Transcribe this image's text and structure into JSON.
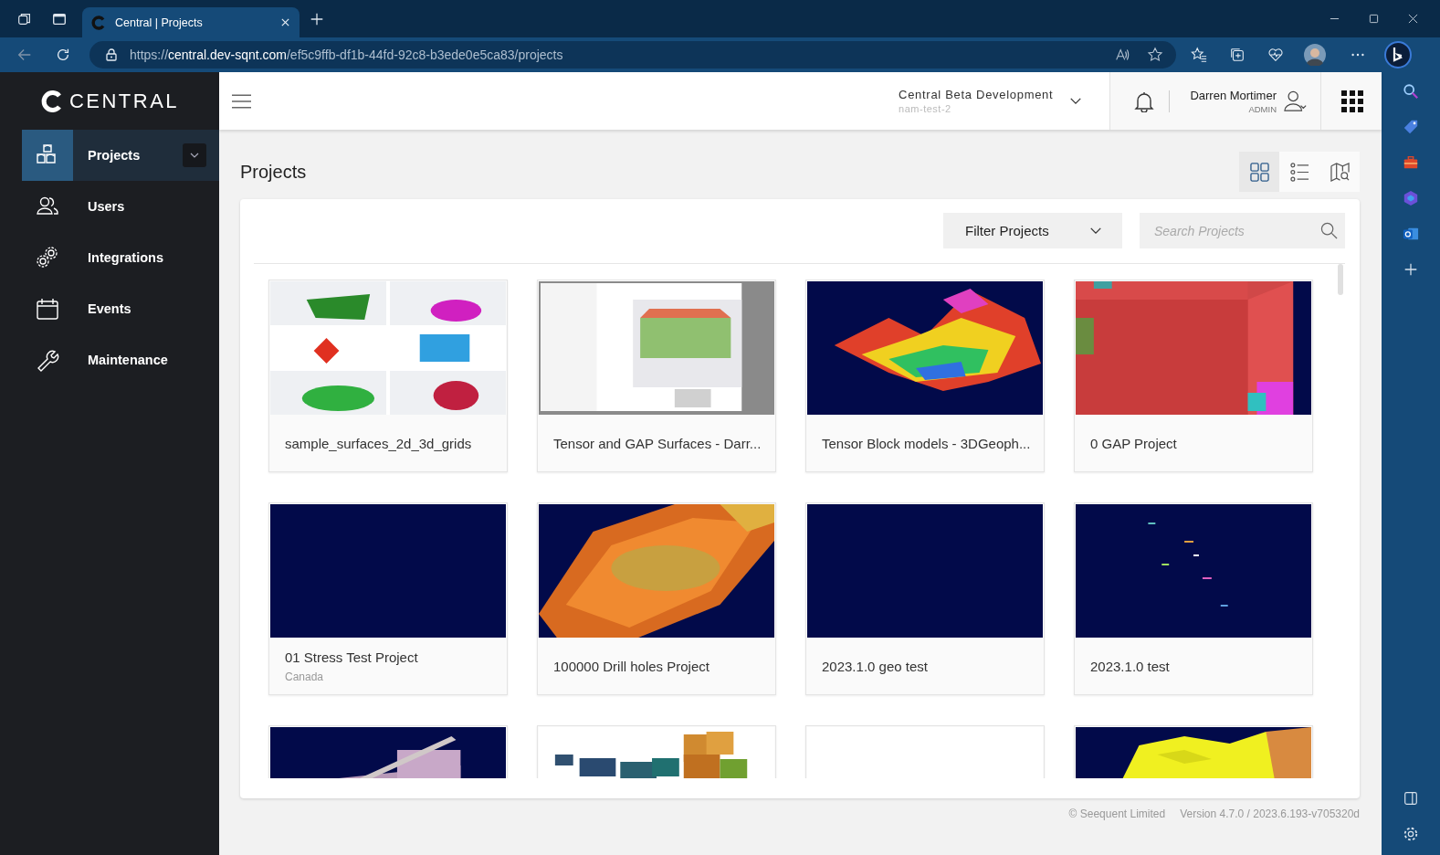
{
  "browser": {
    "tab": {
      "title": "Central | Projects",
      "selected": true
    },
    "url": {
      "scheme": "https://",
      "host": "central.dev-sqnt.com",
      "path": "/ef5c9ffb-df1b-44fd-92c8-b3ede0e5ca83/projects"
    }
  },
  "sidebar": {
    "logo": "CENTRAL",
    "items": [
      {
        "label": "Projects",
        "selected": true,
        "expandable": true
      },
      {
        "label": "Users",
        "selected": false,
        "expandable": false
      },
      {
        "label": "Integrations",
        "selected": false,
        "expandable": false
      },
      {
        "label": "Events",
        "selected": false,
        "expandable": false
      },
      {
        "label": "Maintenance",
        "selected": false,
        "expandable": false
      }
    ]
  },
  "header": {
    "organization": "Central Beta Development",
    "instance": "nam-test-2",
    "user": {
      "name": "Darren Mortimer",
      "role": "ADMIN"
    }
  },
  "page": {
    "title": "Projects",
    "views": [
      {
        "selected": true
      },
      {
        "selected": false
      },
      {
        "selected": false
      }
    ],
    "filter": "Filter Projects",
    "search": {
      "placeholder": "Search Projects"
    }
  },
  "projects": [
    {
      "name": "sample_surfaces_2d_3d_grids",
      "kind": "picture"
    },
    {
      "name": "Tensor and GAP Surfaces - Darr...",
      "kind": "picture"
    },
    {
      "name": "Tensor Block models - 3DGeoph...",
      "kind": "picture"
    },
    {
      "name": "0 GAP Project",
      "kind": "picture"
    },
    {
      "name": "01 Stress Test Project",
      "location": "Canada",
      "kind": "picture"
    },
    {
      "name": "100000 Drill holes Project",
      "kind": "picture"
    },
    {
      "name": "2023.1.0 geo test",
      "kind": "picture"
    },
    {
      "name": "2023.1.0 test",
      "kind": "picture"
    },
    {
      "kind": "picture"
    },
    {
      "kind": "picture"
    },
    {
      "kind": "empty"
    },
    {
      "kind": "picture"
    }
  ],
  "footer": {
    "copyright": "© Seequent Limited",
    "version": "Version 4.7.0 / 2023.6.193-v705320d"
  }
}
